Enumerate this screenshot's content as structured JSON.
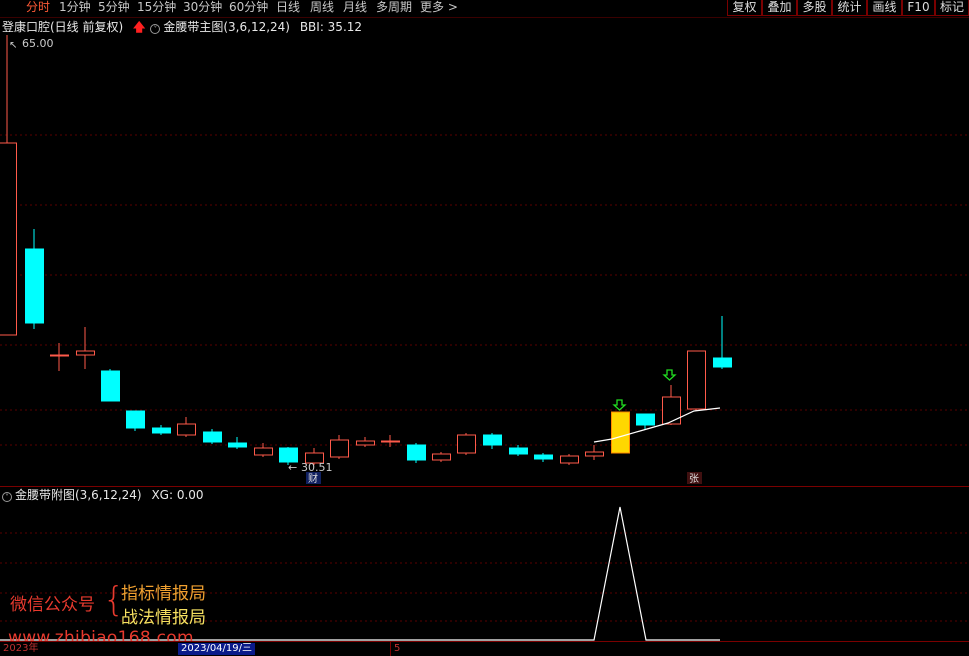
{
  "toolbar": {
    "periods": [
      "分时",
      "1分钟",
      "5分钟",
      "15分钟",
      "30分钟",
      "60分钟",
      "日线",
      "周线",
      "月线",
      "多周期",
      "更多 >"
    ],
    "active_period": "分时",
    "right_buttons": [
      "复权",
      "叠加",
      "多股",
      "统计",
      "画线",
      "F10",
      "标记"
    ]
  },
  "main_panel": {
    "stock_name": "登康口腔(日线 前复权)",
    "indicator_name": "金腰带主图(3,6,12,24)",
    "bbi_label": "BBI: 35.12",
    "high_label": "65.00",
    "low_label": "30.51",
    "badge_cai": "财",
    "badge_zhang": "张"
  },
  "sub_panel": {
    "indicator_name": "金腰带附图(3,6,12,24)",
    "xg_label": "XG: 0.00"
  },
  "watermark": {
    "left": "微信公众号",
    "line1": "指标情报局",
    "line2": "战法情报局",
    "url": "www.zhibiao168.com"
  },
  "footer": {
    "year": "2023年",
    "date": "2023/04/19/三",
    "page": "5"
  },
  "colors": {
    "up": "#ff5a4a",
    "down": "#00ffff",
    "signal": "#ffd700",
    "active": "#ff5a36",
    "frame": "#7a0000"
  }
}
